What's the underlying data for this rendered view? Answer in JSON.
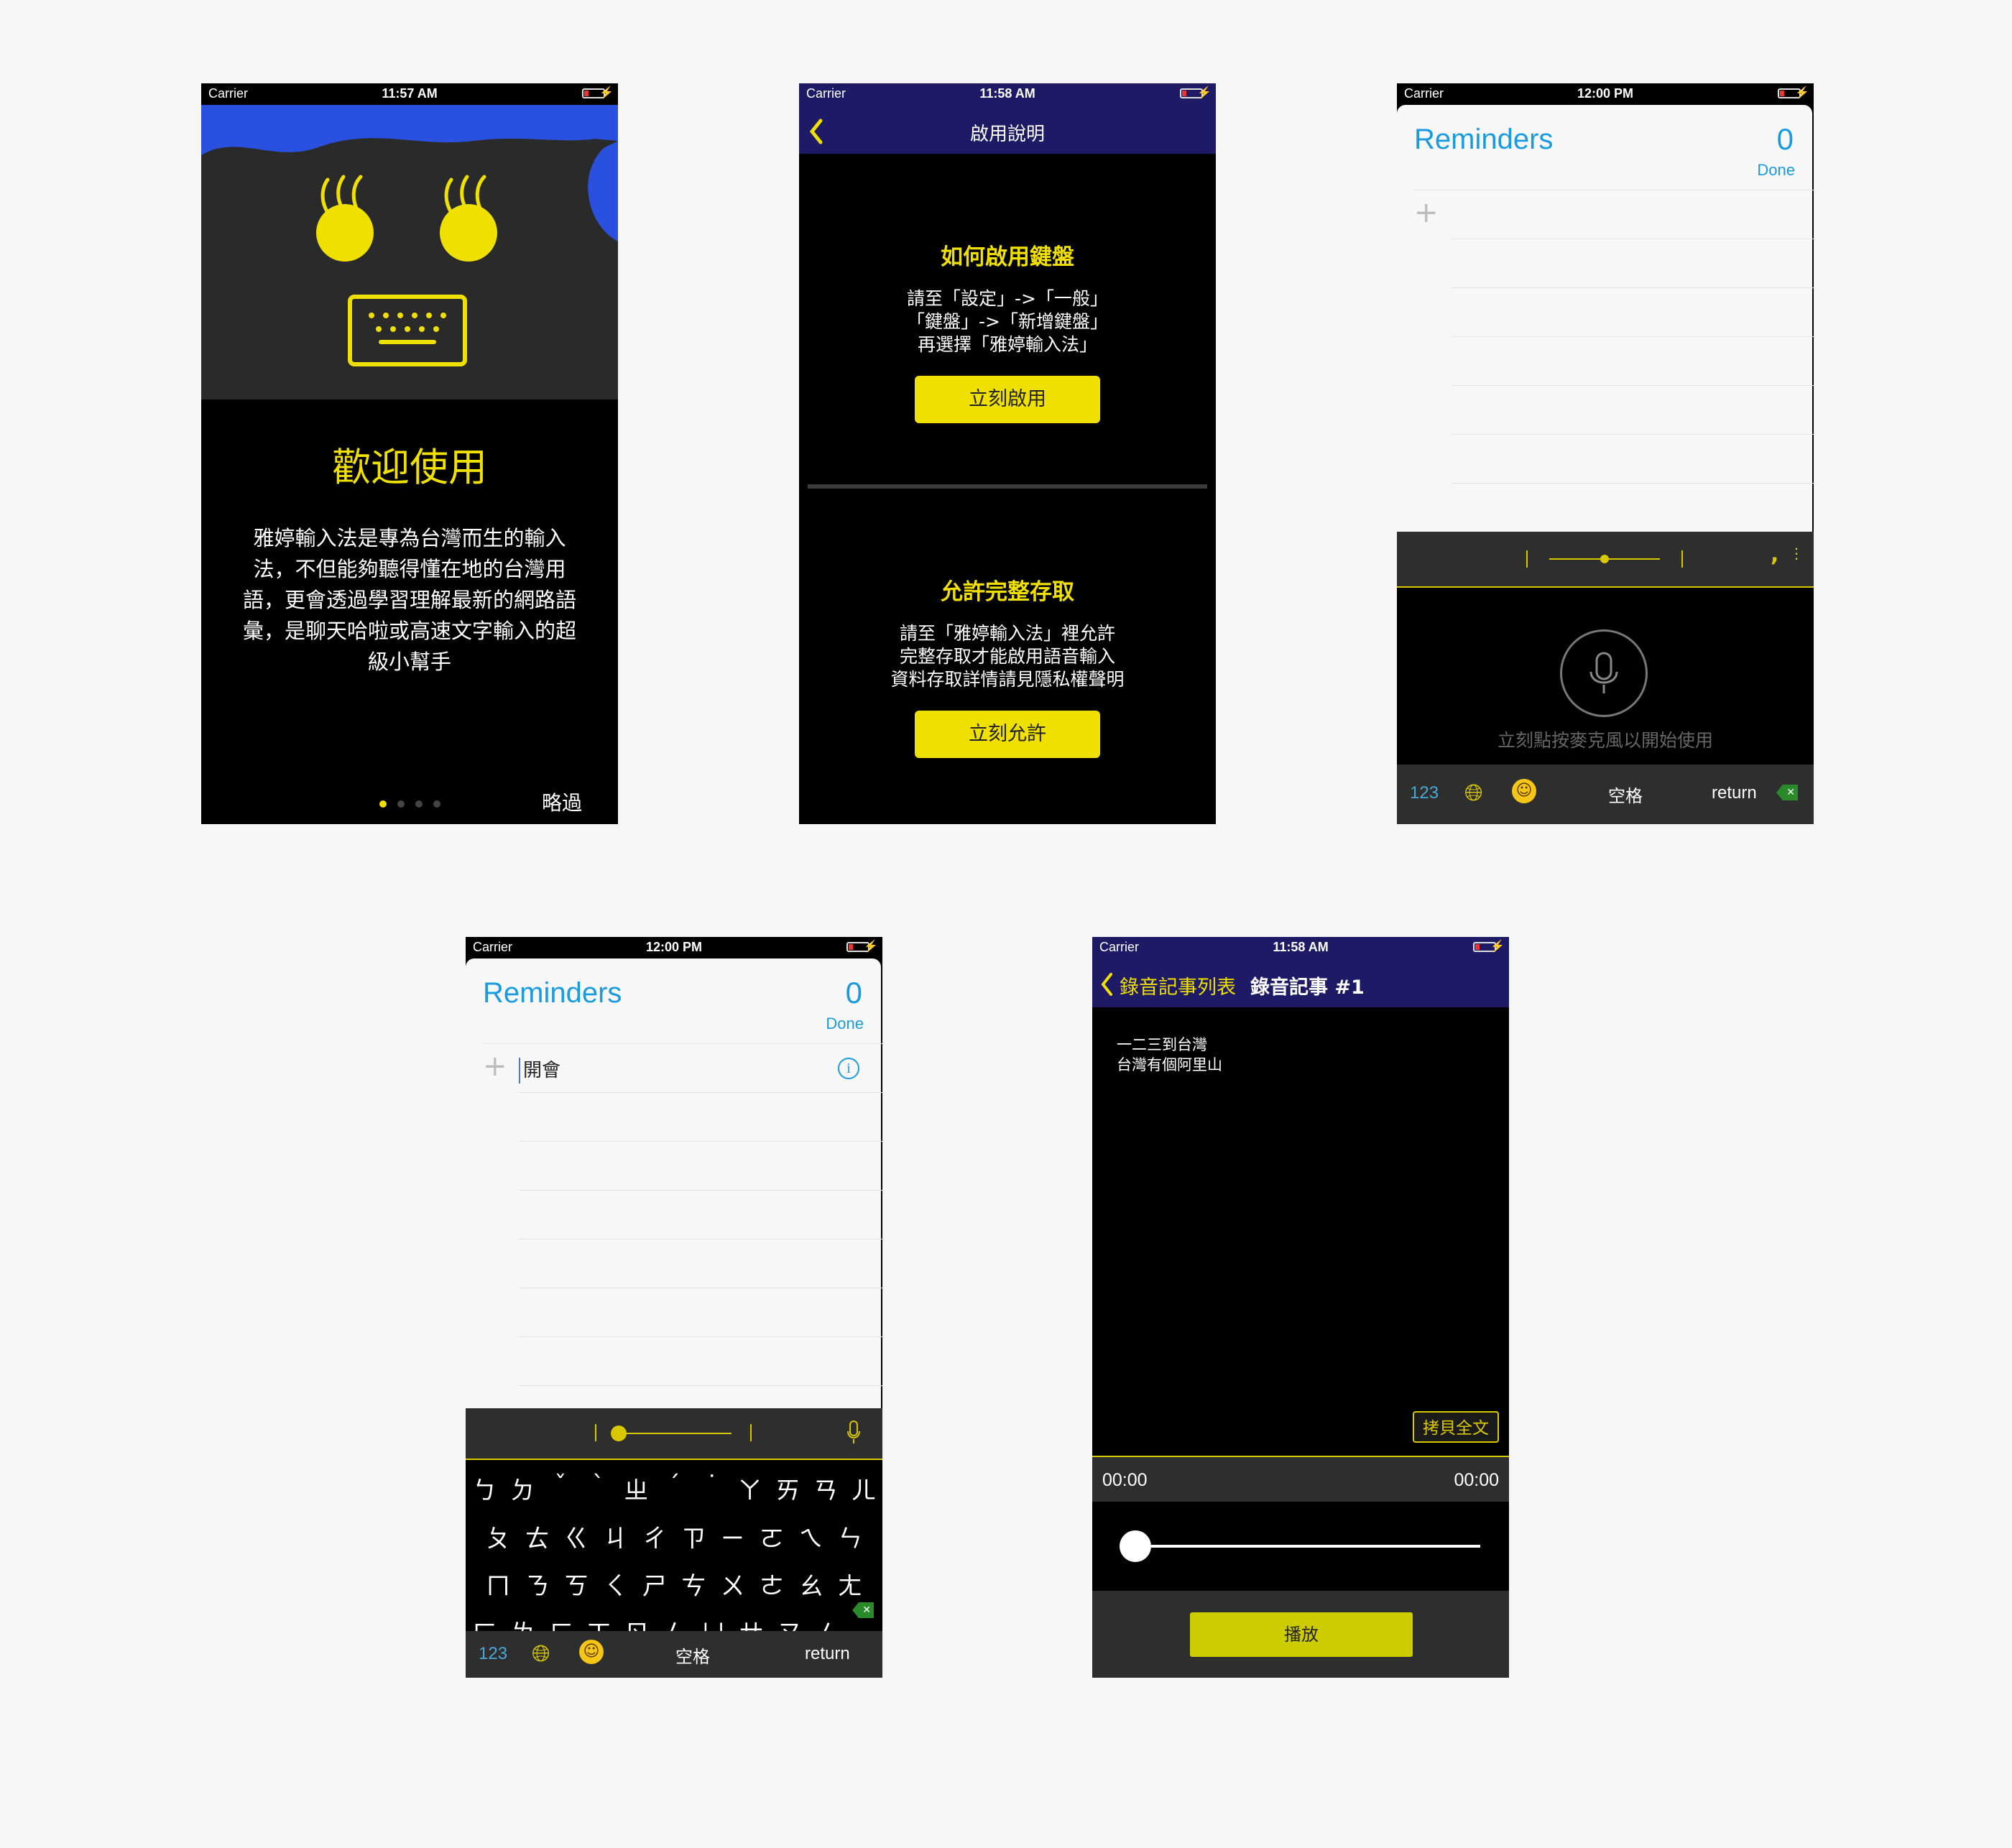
{
  "status": {
    "carrier": "Carrier",
    "times": [
      "11:57 AM",
      "11:58 AM",
      "12:00 PM",
      "12:00 PM",
      "11:58 AM"
    ]
  },
  "welcome": {
    "title": "歡迎使用",
    "body_lines": [
      "雅婷輸入法是專為台灣而生的輸入",
      "法，不但能夠聽得懂在地的台灣用",
      "語，更會透過學習理解最新的網路語",
      "彙，是聊天哈啦或高速文字輸入的超",
      "級小幫手"
    ],
    "skip": "略過",
    "page_index": 1,
    "page_count": 4
  },
  "guide": {
    "nav_title": "啟用說明",
    "s1_title": "如何啟用鍵盤",
    "s1_lines": [
      "請至「設定」->「一般」",
      "「鍵盤」->「新增鍵盤」",
      "再選擇「雅婷輸入法」"
    ],
    "s1_button": "立刻啟用",
    "s2_title": "允許完整存取",
    "s2_lines": [
      "請至「雅婷輸入法」裡允許",
      "完整存取才能啟用語音輸入",
      "資料存取詳情請見隱私權聲明"
    ],
    "s2_button": "立刻允許"
  },
  "reminders": {
    "title": "Reminders",
    "count": "0",
    "done": "Done",
    "item_text": "開會"
  },
  "keyboard": {
    "mic_hint": "立刻點按麥克風以開始使用",
    "numbers": "123",
    "space": "空格",
    "return": "return",
    "punct": ", ",
    "rows": [
      [
        "ㄅ",
        "ㄉ",
        "ˇ",
        "ˋ",
        "ㄓ",
        "ˊ",
        "˙",
        "ㄚ",
        "ㄞ",
        "ㄢ",
        "ㄦ"
      ],
      [
        "ㄆ",
        "ㄊ",
        "ㄍ",
        "ㄐ",
        "ㄔ",
        "ㄗ",
        "ㄧ",
        "ㄛ",
        "ㄟ",
        "ㄣ"
      ],
      [
        "ㄇ",
        "ㄋ",
        "ㄎ",
        "ㄑ",
        "ㄕ",
        "ㄘ",
        "ㄨ",
        "ㄜ",
        "ㄠ",
        "ㄤ"
      ],
      [
        "ㄈ",
        "ㄌ",
        "ㄏ",
        "ㄒ",
        "ㄖ",
        "ㄙ",
        "ㄩ",
        "ㄝ",
        "ㄡ",
        "ㄥ"
      ]
    ]
  },
  "memo": {
    "back_label": "錄音記事列表",
    "title": "錄音記事 #1",
    "lines": [
      "一二三到台灣",
      "台灣有個阿里山"
    ],
    "copy_button": "拷貝全文",
    "time_start": "00:00",
    "time_end": "00:00",
    "play_button": "播放",
    "progress": 0
  },
  "colors": {
    "yellow": "#f0e000",
    "nav_purple": "#1e1a66",
    "blue": "#2a50e0",
    "ios_blue": "#1a9be0"
  }
}
